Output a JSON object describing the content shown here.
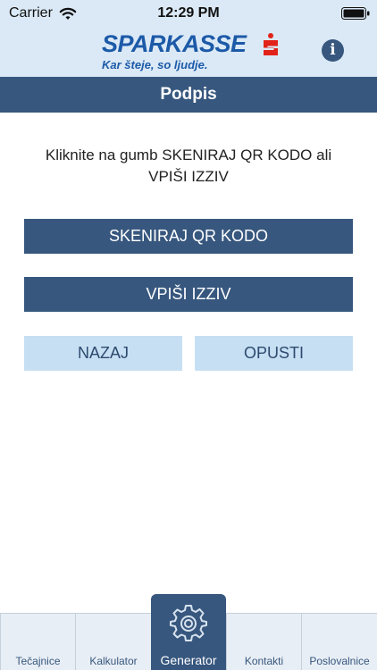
{
  "status": {
    "carrier": "Carrier",
    "time": "12:29 PM"
  },
  "brand": {
    "name": "SPARKASSE",
    "tagline": "Kar šteje, so ljudje."
  },
  "header": {
    "title": "Podpis",
    "info_icon": "i"
  },
  "main": {
    "instruction_line1": "Kliknite na gumb SKENIRAJ QR KODO ali",
    "instruction_line2": "VPIŠI IZZIV",
    "scan_button": "SKENIRAJ QR KODO",
    "enter_button": "VPIŠI IZZIV",
    "back_button": "NAZAJ",
    "cancel_button": "OPUSTI"
  },
  "tabs": [
    {
      "label": "Tečajnice"
    },
    {
      "label": "Kalkulator"
    },
    {
      "label": "Generator",
      "icon": "gear-icon"
    },
    {
      "label": "Kontakti"
    },
    {
      "label": "Poslovalnice"
    }
  ],
  "colors": {
    "primary": "#37577e",
    "secondary": "#c7dff3",
    "brand": "#1c5aa8",
    "brand_red": "#e2231a",
    "header_bg": "#dbe9f6"
  }
}
